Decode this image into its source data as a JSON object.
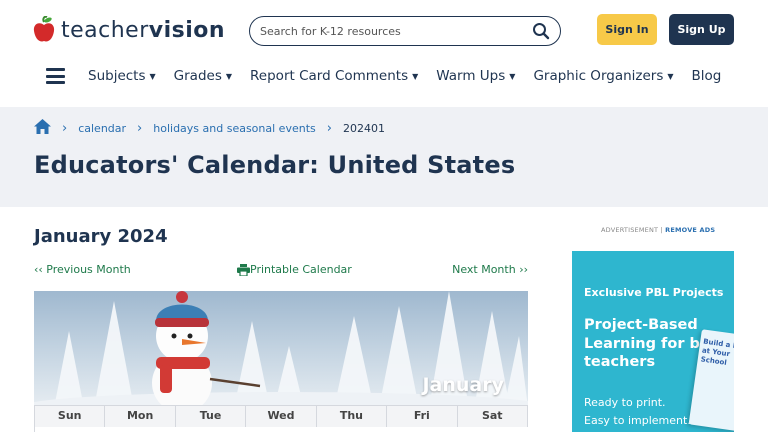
{
  "header": {
    "logo_part1": "teacher",
    "logo_part2": "vision",
    "search_placeholder": "Search for K-12 resources",
    "signin_label": "Sign In",
    "signup_label": "Sign Up"
  },
  "nav": {
    "items": [
      {
        "label": "Subjects",
        "dropdown": true
      },
      {
        "label": "Grades",
        "dropdown": true
      },
      {
        "label": "Report Card Comments",
        "dropdown": true
      },
      {
        "label": "Warm Ups",
        "dropdown": true
      },
      {
        "label": "Graphic Organizers",
        "dropdown": true
      },
      {
        "label": "Blog",
        "dropdown": false
      }
    ]
  },
  "breadcrumb": {
    "items": [
      "calendar",
      "holidays and seasonal events"
    ],
    "current": "202401"
  },
  "page": {
    "title": "Educators' Calendar: United States",
    "month_heading": "January 2024",
    "prev_label": "‹‹ Previous Month",
    "print_label": "Printable Calendar",
    "next_label": "Next Month ››",
    "hero_label": "January"
  },
  "calendar": {
    "weekdays": [
      "Sun",
      "Mon",
      "Tue",
      "Wed",
      "Thu",
      "Fri",
      "Sat"
    ]
  },
  "ad": {
    "label": "ADVERTISEMENT | ",
    "remove": "REMOVE ADS",
    "kicker": "Exclusive PBL Projects",
    "headline": "Project-Based Learning for busy teachers",
    "line1": "Ready to print.",
    "line2": "Easy to implement.",
    "card_text": "Build a Pool at Your School"
  },
  "colors": {
    "navy": "#1f3450",
    "link_blue": "#2a6fb0",
    "green": "#1f7a4b",
    "yellow": "#f7c948",
    "ad_teal": "#2eb6cf"
  }
}
